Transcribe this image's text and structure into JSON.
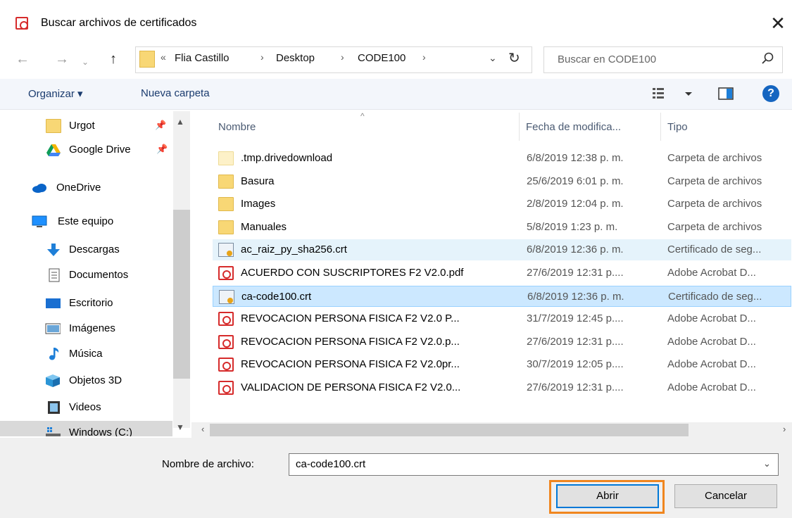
{
  "window": {
    "title": "Buscar archivos de certificados",
    "close": "✕"
  },
  "address": {
    "overflow": "«",
    "crumbs": [
      "Flia Castillo",
      "Desktop",
      "CODE100"
    ],
    "separator": "›",
    "search_placeholder": "Buscar en CODE100"
  },
  "toolbar": {
    "organize": "Organizar ▾",
    "new_folder": "Nueva carpeta",
    "help": "?"
  },
  "sidebar": {
    "items": [
      {
        "label": "Urgot",
        "icon": "folder-icon",
        "pinned": true
      },
      {
        "label": "Google Drive",
        "icon": "google-drive-icon",
        "pinned": true
      },
      {
        "label": "OneDrive",
        "icon": "onedrive-icon",
        "pinned": false
      },
      {
        "label": "Este equipo",
        "icon": "computer-icon",
        "pinned": false
      },
      {
        "label": "Descargas",
        "icon": "download-icon",
        "pinned": false
      },
      {
        "label": "Documentos",
        "icon": "documents-icon",
        "pinned": false
      },
      {
        "label": "Escritorio",
        "icon": "desktop-icon",
        "pinned": false
      },
      {
        "label": "Imágenes",
        "icon": "pictures-icon",
        "pinned": false
      },
      {
        "label": "Música",
        "icon": "music-icon",
        "pinned": false
      },
      {
        "label": "Objetos 3D",
        "icon": "3d-objects-icon",
        "pinned": false
      },
      {
        "label": "Videos",
        "icon": "videos-icon",
        "pinned": false
      },
      {
        "label": "Windows (C:)",
        "icon": "drive-icon",
        "pinned": false
      }
    ]
  },
  "filelist": {
    "columns": [
      "Nombre",
      "Fecha de modifica...",
      "Tipo"
    ],
    "rows": [
      {
        "name": ".tmp.drivedownload",
        "date": "6/8/2019 12:38 p. m.",
        "type": "Carpeta de archivos",
        "icon": "folder-light"
      },
      {
        "name": "Basura",
        "date": "25/6/2019 6:01 p. m.",
        "type": "Carpeta de archivos",
        "icon": "folder"
      },
      {
        "name": "Images",
        "date": "2/8/2019 12:04 p. m.",
        "type": "Carpeta de archivos",
        "icon": "folder"
      },
      {
        "name": "Manuales",
        "date": "5/8/2019 1:23 p. m.",
        "type": "Carpeta de archivos",
        "icon": "folder"
      },
      {
        "name": "ac_raiz_py_sha256.crt",
        "date": "6/8/2019 12:36 p. m.",
        "type": "Certificado de seg...",
        "icon": "cert"
      },
      {
        "name": "ACUERDO CON SUSCRIPTORES F2 V2.0.pdf",
        "date": "27/6/2019 12:31 p....",
        "type": "Adobe Acrobat D...",
        "icon": "pdf"
      },
      {
        "name": "ca-code100.crt",
        "date": "6/8/2019 12:36 p. m.",
        "type": "Certificado de seg...",
        "icon": "cert"
      },
      {
        "name": "REVOCACION PERSONA FISICA F2 V2.0 P...",
        "date": "31/7/2019 12:45 p....",
        "type": "Adobe Acrobat D...",
        "icon": "pdf"
      },
      {
        "name": "REVOCACION PERSONA FISICA F2 V2.0.p...",
        "date": "27/6/2019 12:31 p....",
        "type": "Adobe Acrobat D...",
        "icon": "pdf"
      },
      {
        "name": "REVOCACION PERSONA FISICA F2 V2.0pr...",
        "date": "30/7/2019 12:05 p....",
        "type": "Adobe Acrobat D...",
        "icon": "pdf"
      },
      {
        "name": "VALIDACION DE PERSONA FISICA F2 V2.0...",
        "date": "27/6/2019 12:31 p....",
        "type": "Adobe Acrobat D...",
        "icon": "pdf"
      }
    ],
    "selected_index": 6,
    "hover_index": 4
  },
  "footer": {
    "filename_label": "Nombre de archivo:",
    "filename_value": "ca-code100.crt",
    "open_label": "Abrir",
    "cancel_label": "Cancelar"
  },
  "colors": {
    "accent": "#0078d7",
    "highlight_border": "#f0861f",
    "selection": "#cce8ff"
  }
}
